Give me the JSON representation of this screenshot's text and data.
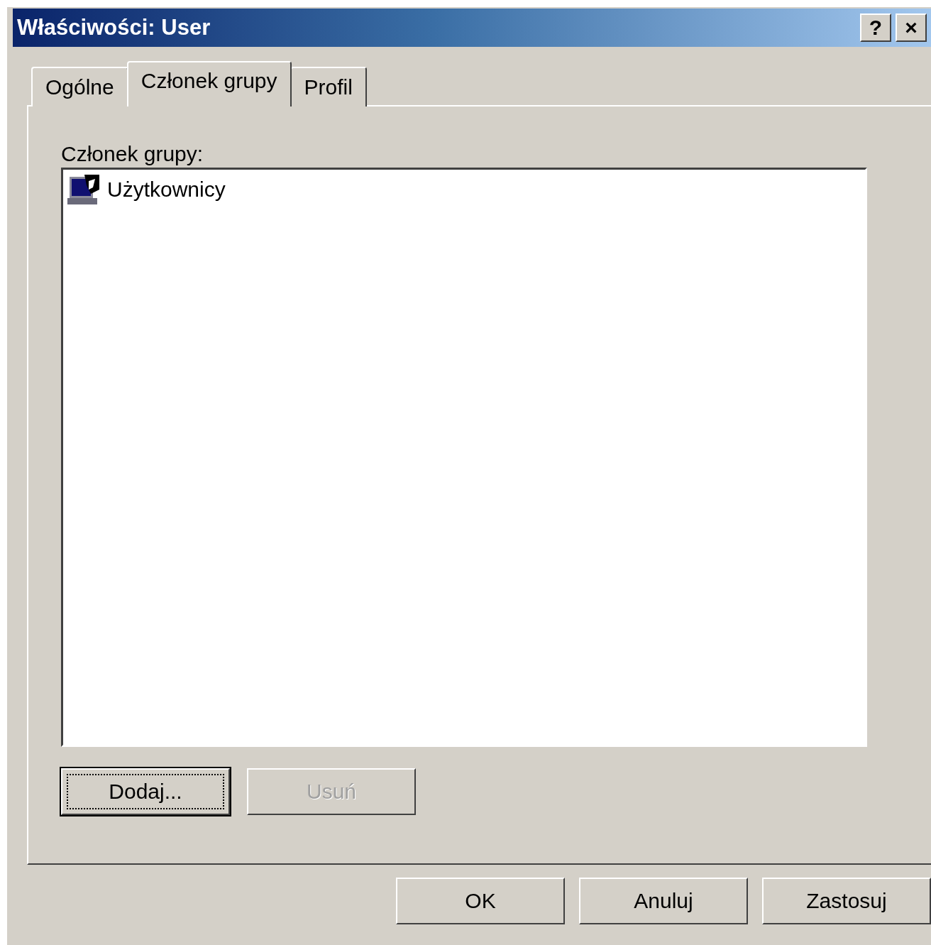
{
  "window": {
    "title": "Właściwości: User",
    "help_button": "?",
    "close_button": "×"
  },
  "tabs": [
    {
      "label": "Ogólne",
      "selected": false
    },
    {
      "label": "Członek grupy",
      "selected": true
    },
    {
      "label": "Profil",
      "selected": false
    }
  ],
  "members_label": "Członek grupy:",
  "members": [
    {
      "name": "Użytkownicy",
      "selected": false
    }
  ],
  "list_buttons": [
    {
      "label": "Dodaj...",
      "disabled": false,
      "focused": true
    },
    {
      "label": "Usuń",
      "disabled": true,
      "focused": false
    }
  ],
  "dialog_buttons": [
    {
      "label": "OK",
      "disabled": false
    },
    {
      "label": "Anuluj",
      "disabled": false
    },
    {
      "label": "Zastosuj",
      "disabled": false
    }
  ]
}
